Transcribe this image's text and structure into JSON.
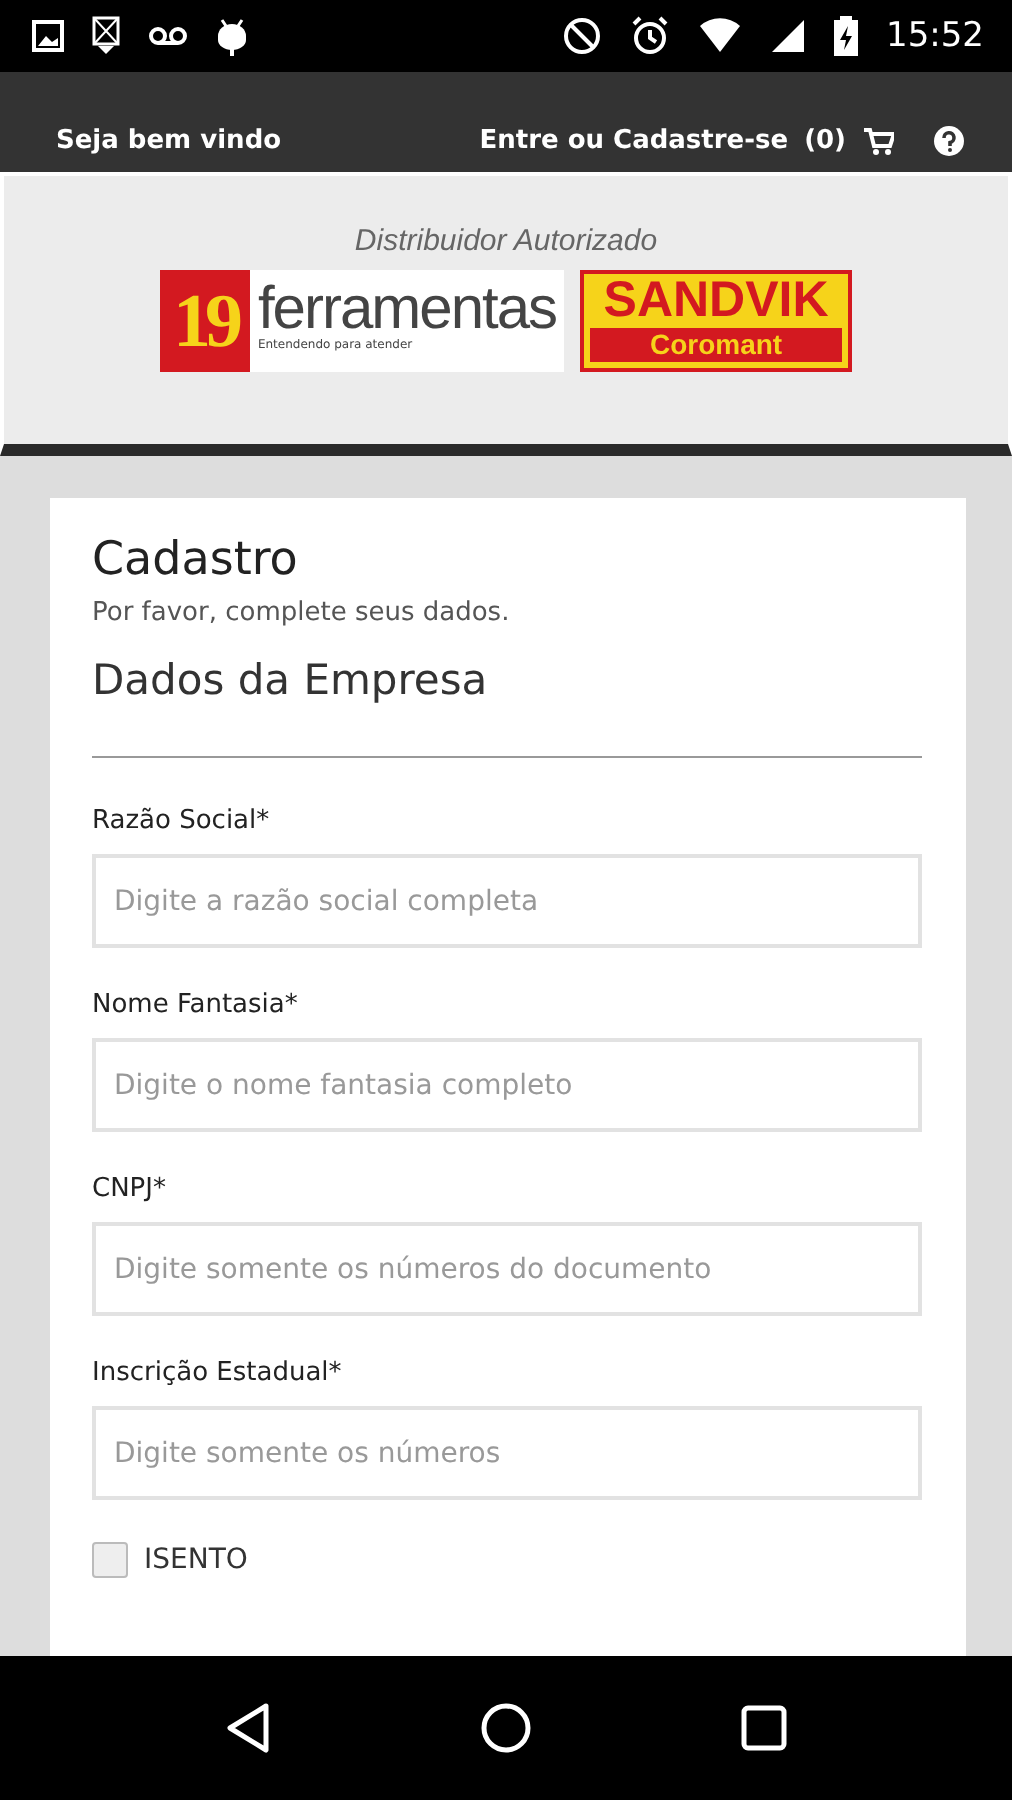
{
  "status_bar": {
    "time": "15:52"
  },
  "header": {
    "welcome": "Seja bem vindo",
    "login": "Entre ou Cadastre-se",
    "cart_count": "(0)"
  },
  "banner": {
    "caption": "Distribuidor Autorizado",
    "logo_number": "19",
    "logo_name": "ferramentas",
    "logo_tagline": "Entendendo para atender",
    "partner_name": "SANDVIK",
    "partner_sub": "Coromant"
  },
  "form": {
    "title": "Cadastro",
    "subtitle": "Por favor, complete seus dados.",
    "section": "Dados da Empresa",
    "fields": [
      {
        "label": "Razão Social*",
        "placeholder": "Digite a razão social completa"
      },
      {
        "label": "Nome Fantasia*",
        "placeholder": "Digite o nome fantasia completo"
      },
      {
        "label": "CNPJ*",
        "placeholder": "Digite somente os números do documento"
      },
      {
        "label": "Inscrição Estadual*",
        "placeholder": "Digite somente os números"
      }
    ],
    "checkbox": {
      "label": "ISENTO",
      "checked": false
    }
  }
}
